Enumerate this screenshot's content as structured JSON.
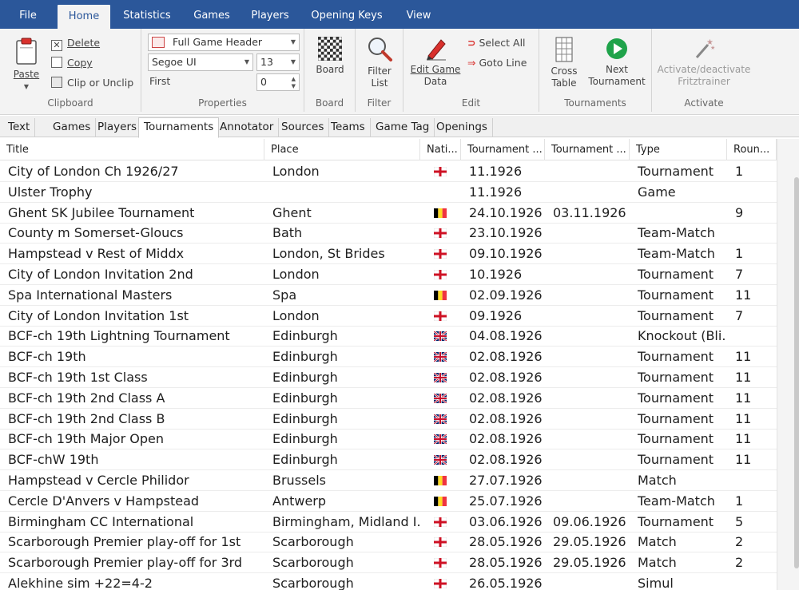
{
  "ribbon_tabs": [
    "File",
    "Home",
    "Statistics",
    "Games",
    "Players",
    "Opening Keys",
    "View"
  ],
  "clipboard": {
    "paste": "Paste",
    "delete": "Delete",
    "copy": "Copy",
    "clip": "Clip or Unclip",
    "label": "Clipboard"
  },
  "properties": {
    "header_select": "Full Game Header",
    "font_select": "Segoe UI",
    "size_select": "13",
    "first_label": "First",
    "first_value": "0",
    "label": "Properties"
  },
  "board_group": {
    "board": "Board",
    "label": "Board"
  },
  "filter_group": {
    "filter_line1": "Filter",
    "filter_line2": "List",
    "label": "Filter"
  },
  "edit_group": {
    "edit_line1": "Edit Game",
    "edit_line2": "Data",
    "select_all": "Select All",
    "goto_line": "Goto Line",
    "label": "Edit"
  },
  "tournaments_group": {
    "cross_line1": "Cross",
    "cross_line2": "Table",
    "next_line1": "Next",
    "next_line2": "Tournament",
    "label": "Tournaments"
  },
  "activate_group": {
    "line1": "Activate/deactivate",
    "line2": "Fritztrainer",
    "label": "Activate"
  },
  "sub_tabs": [
    "Text",
    "Games",
    "Players",
    "Tournaments",
    "Annotator",
    "Sources",
    "Teams",
    "Game Tag",
    "Openings"
  ],
  "columns": [
    "Title",
    "Place",
    "Nati...",
    "Tournament ...",
    "Tournament ...",
    "Type",
    "Roun..."
  ],
  "rows": [
    {
      "title": "City of London Ch 1926/27",
      "place": "London",
      "flag": "eng",
      "start": "11.1926",
      "end": "",
      "type": "Tournament",
      "rounds": "1"
    },
    {
      "title": "Ulster Trophy",
      "place": "",
      "flag": "",
      "start": "11.1926",
      "end": "",
      "type": "Game",
      "rounds": ""
    },
    {
      "title": "Ghent SK Jubilee Tournament",
      "place": "Ghent",
      "flag": "bel",
      "start": "24.10.1926",
      "end": "03.11.1926",
      "type": "",
      "rounds": "9"
    },
    {
      "title": "County m Somerset-Gloucs",
      "place": "Bath",
      "flag": "eng",
      "start": "23.10.1926",
      "end": "",
      "type": "Team-Match",
      "rounds": ""
    },
    {
      "title": "Hampstead v Rest of Middx",
      "place": "London, St Brides",
      "flag": "eng",
      "start": "09.10.1926",
      "end": "",
      "type": "Team-Match",
      "rounds": "1"
    },
    {
      "title": "City of London Invitation 2nd",
      "place": "London",
      "flag": "eng",
      "start": "10.1926",
      "end": "",
      "type": "Tournament",
      "rounds": "7"
    },
    {
      "title": "Spa International Masters",
      "place": "Spa",
      "flag": "bel",
      "start": "02.09.1926",
      "end": "",
      "type": "Tournament",
      "rounds": "11"
    },
    {
      "title": "City of London Invitation 1st",
      "place": "London",
      "flag": "eng",
      "start": "09.1926",
      "end": "",
      "type": "Tournament",
      "rounds": "7"
    },
    {
      "title": "BCF-ch 19th Lightning Tournament",
      "place": "Edinburgh",
      "flag": "uk",
      "start": "04.08.1926",
      "end": "",
      "type": "Knockout (Bli...",
      "rounds": ""
    },
    {
      "title": "BCF-ch 19th",
      "place": "Edinburgh",
      "flag": "uk",
      "start": "02.08.1926",
      "end": "",
      "type": "Tournament",
      "rounds": "11"
    },
    {
      "title": "BCF-ch 19th 1st Class",
      "place": "Edinburgh",
      "flag": "uk",
      "start": "02.08.1926",
      "end": "",
      "type": "Tournament",
      "rounds": "11"
    },
    {
      "title": "BCF-ch 19th 2nd Class A",
      "place": "Edinburgh",
      "flag": "uk",
      "start": "02.08.1926",
      "end": "",
      "type": "Tournament",
      "rounds": "11"
    },
    {
      "title": "BCF-ch 19th 2nd Class B",
      "place": "Edinburgh",
      "flag": "uk",
      "start": "02.08.1926",
      "end": "",
      "type": "Tournament",
      "rounds": "11"
    },
    {
      "title": "BCF-ch 19th Major Open",
      "place": "Edinburgh",
      "flag": "uk",
      "start": "02.08.1926",
      "end": "",
      "type": "Tournament",
      "rounds": "11"
    },
    {
      "title": "BCF-chW 19th",
      "place": "Edinburgh",
      "flag": "uk",
      "start": "02.08.1926",
      "end": "",
      "type": "Tournament",
      "rounds": "11"
    },
    {
      "title": "Hampstead v Cercle Philidor",
      "place": "Brussels",
      "flag": "bel",
      "start": "27.07.1926",
      "end": "",
      "type": "Match",
      "rounds": ""
    },
    {
      "title": "Cercle D'Anvers v Hampstead",
      "place": "Antwerp",
      "flag": "bel",
      "start": "25.07.1926",
      "end": "",
      "type": "Team-Match",
      "rounds": "1"
    },
    {
      "title": "Birmingham CC International",
      "place": "Birmingham, Midland I...",
      "flag": "eng",
      "start": "03.06.1926",
      "end": "09.06.1926",
      "type": "Tournament",
      "rounds": "5"
    },
    {
      "title": "Scarborough Premier play-off for 1st",
      "place": "Scarborough",
      "flag": "eng",
      "start": "28.05.1926",
      "end": "29.05.1926",
      "type": "Match",
      "rounds": "2"
    },
    {
      "title": "Scarborough Premier play-off for 3rd",
      "place": "Scarborough",
      "flag": "eng",
      "start": "28.05.1926",
      "end": "29.05.1926",
      "type": "Match",
      "rounds": "2"
    },
    {
      "title": "Alekhine sim +22=4-2",
      "place": "Scarborough",
      "flag": "eng",
      "start": "26.05.1926",
      "end": "",
      "type": "Simul",
      "rounds": ""
    }
  ],
  "colors": {
    "ribbon_blue": "#2b579a",
    "ribbon_bg": "#f3f3f3",
    "next_green": "#1fa34a"
  }
}
